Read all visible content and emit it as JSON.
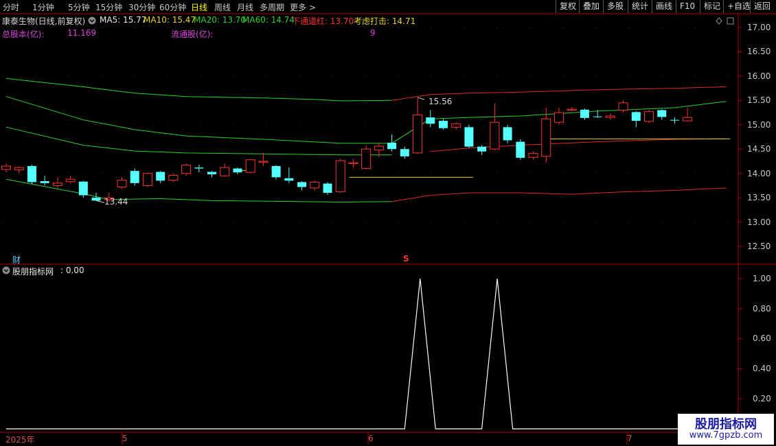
{
  "toolbar": {
    "periods": [
      "分时",
      "1分钟",
      "5分钟",
      "15分钟",
      "30分钟",
      "60分钟",
      "日线",
      "周线",
      "月线",
      "多周期",
      "更多 >"
    ],
    "active_period": "日线",
    "tools": [
      "复权",
      "叠加",
      "多股",
      "统计",
      "画线",
      "F10",
      "标记",
      "+自选",
      "返回"
    ]
  },
  "stock": {
    "title": "康泰生物(日线,前复权)"
  },
  "ma": {
    "ma5": "MA5: 15.77",
    "ma10": "MA10: 15.47",
    "ma20": "MA20: 13.70",
    "ma60": "MA60: 14.74"
  },
  "signals": {
    "lower": "下通道红: 13.70",
    "consider": "考虑打击: 14.71"
  },
  "shares": {
    "total_label": "总股本(亿):",
    "total_value": "11.169",
    "float_label": "流通股(亿):",
    "float_value": "9"
  },
  "price_axis": [
    "17.00",
    "16.50",
    "16.00",
    "15.50",
    "15.00",
    "14.50",
    "14.00",
    "13.50",
    "13.00",
    "12.50"
  ],
  "annotations": {
    "high": "15.56",
    "low": "13.44"
  },
  "markers": {
    "cai": "财",
    "s": "S"
  },
  "indicator": {
    "name": "股朋指标网",
    "value_text": ": 0.00",
    "axis": [
      "1.00",
      "0.80",
      "0.60",
      "0.40",
      "0.20"
    ]
  },
  "dates": [
    "2025年",
    "5",
    "6",
    "7"
  ],
  "watermark": {
    "line1": "股朋指标网",
    "line2": "www.7gpzb.com"
  },
  "colors": {
    "up": "#ff3232",
    "down": "#54ffff",
    "ma_green": "#2bd12b",
    "ma_red": "#dd2a2a",
    "axis_red": "#b00000",
    "consider_yellow": "#e6d22c"
  },
  "chart_data": [
    {
      "type": "candlestick",
      "title": "康泰生物(日线,前复权)",
      "ylim": [
        12.3,
        17.2
      ],
      "candles": [
        {
          "o": 14.08,
          "c": 14.15,
          "h": 14.2,
          "l": 14.02
        },
        {
          "o": 14.07,
          "c": 14.12,
          "h": 14.15,
          "l": 14.0
        },
        {
          "o": 14.15,
          "c": 13.82,
          "h": 14.18,
          "l": 13.78
        },
        {
          "o": 13.84,
          "c": 13.8,
          "h": 13.95,
          "l": 13.75
        },
        {
          "o": 13.75,
          "c": 13.8,
          "h": 13.92,
          "l": 13.7
        },
        {
          "o": 13.83,
          "c": 13.88,
          "h": 13.95,
          "l": 13.79
        },
        {
          "o": 13.83,
          "c": 13.55,
          "h": 13.85,
          "l": 13.5
        },
        {
          "o": 13.5,
          "c": 13.44,
          "h": 13.6,
          "l": 13.44
        },
        {
          "o": 13.46,
          "c": 13.5,
          "h": 13.6,
          "l": 13.42
        },
        {
          "o": 13.72,
          "c": 13.86,
          "h": 13.92,
          "l": 13.68
        },
        {
          "o": 14.05,
          "c": 13.8,
          "h": 14.1,
          "l": 13.75
        },
        {
          "o": 13.75,
          "c": 14.0,
          "h": 14.02,
          "l": 13.72
        },
        {
          "o": 14.03,
          "c": 13.85,
          "h": 14.05,
          "l": 13.8
        },
        {
          "o": 13.86,
          "c": 13.96,
          "h": 14.0,
          "l": 13.82
        },
        {
          "o": 14.0,
          "c": 14.17,
          "h": 14.2,
          "l": 13.95
        },
        {
          "o": 14.12,
          "c": 14.1,
          "h": 14.18,
          "l": 14.02
        },
        {
          "o": 14.03,
          "c": 13.98,
          "h": 14.05,
          "l": 13.92
        },
        {
          "o": 13.95,
          "c": 14.12,
          "h": 14.2,
          "l": 13.93
        },
        {
          "o": 14.1,
          "c": 14.02,
          "h": 14.12,
          "l": 13.98
        },
        {
          "o": 14.02,
          "c": 14.28,
          "h": 14.3,
          "l": 14.0
        },
        {
          "o": 14.23,
          "c": 14.25,
          "h": 14.42,
          "l": 14.15
        },
        {
          "o": 14.15,
          "c": 13.92,
          "h": 14.17,
          "l": 13.88
        },
        {
          "o": 13.9,
          "c": 13.85,
          "h": 14.12,
          "l": 13.8
        },
        {
          "o": 13.82,
          "c": 13.72,
          "h": 13.84,
          "l": 13.65
        },
        {
          "o": 13.7,
          "c": 13.82,
          "h": 13.85,
          "l": 13.65
        },
        {
          "o": 13.79,
          "c": 13.6,
          "h": 13.82,
          "l": 13.56
        },
        {
          "o": 13.62,
          "c": 14.26,
          "h": 14.3,
          "l": 13.6
        },
        {
          "o": 14.2,
          "c": 14.22,
          "h": 14.3,
          "l": 14.12
        },
        {
          "o": 14.1,
          "c": 14.5,
          "h": 14.58,
          "l": 14.08
        },
        {
          "o": 14.48,
          "c": 14.56,
          "h": 14.62,
          "l": 14.33
        },
        {
          "o": 14.63,
          "c": 14.5,
          "h": 14.8,
          "l": 14.45
        },
        {
          "o": 14.5,
          "c": 14.35,
          "h": 14.55,
          "l": 14.3
        },
        {
          "o": 14.42,
          "c": 15.2,
          "h": 15.56,
          "l": 14.4
        },
        {
          "o": 15.15,
          "c": 15.02,
          "h": 15.3,
          "l": 14.95
        },
        {
          "o": 15.08,
          "c": 14.93,
          "h": 15.12,
          "l": 14.9
        },
        {
          "o": 14.95,
          "c": 15.02,
          "h": 15.05,
          "l": 14.9
        },
        {
          "o": 14.95,
          "c": 14.55,
          "h": 15.0,
          "l": 14.52
        },
        {
          "o": 14.55,
          "c": 14.45,
          "h": 14.58,
          "l": 14.38
        },
        {
          "o": 14.5,
          "c": 15.05,
          "h": 15.44,
          "l": 14.47
        },
        {
          "o": 14.95,
          "c": 14.68,
          "h": 15.0,
          "l": 14.62
        },
        {
          "o": 14.65,
          "c": 14.32,
          "h": 14.7,
          "l": 14.28
        },
        {
          "o": 14.33,
          "c": 14.41,
          "h": 14.45,
          "l": 14.28
        },
        {
          "o": 14.35,
          "c": 15.12,
          "h": 15.35,
          "l": 14.22
        },
        {
          "o": 15.05,
          "c": 15.25,
          "h": 15.35,
          "l": 15.0
        },
        {
          "o": 15.3,
          "c": 15.32,
          "h": 15.36,
          "l": 15.28
        },
        {
          "o": 15.31,
          "c": 15.14,
          "h": 15.33,
          "l": 15.1
        },
        {
          "o": 15.17,
          "c": 15.16,
          "h": 15.3,
          "l": 15.14
        },
        {
          "o": 15.15,
          "c": 15.18,
          "h": 15.23,
          "l": 15.1
        },
        {
          "o": 15.3,
          "c": 15.45,
          "h": 15.5,
          "l": 15.25
        },
        {
          "o": 15.26,
          "c": 15.08,
          "h": 15.28,
          "l": 14.95
        },
        {
          "o": 15.07,
          "c": 15.27,
          "h": 15.3,
          "l": 15.03
        },
        {
          "o": 15.3,
          "c": 15.16,
          "h": 15.32,
          "l": 15.1
        },
        {
          "o": 15.1,
          "c": 15.09,
          "h": 15.15,
          "l": 15.02
        },
        {
          "o": 15.08,
          "c": 15.15,
          "h": 15.35,
          "l": 15.06
        }
      ],
      "bands": {
        "upper_outer": [
          [
            0,
            15.95
          ],
          [
            6,
            15.78
          ],
          [
            10,
            15.65
          ],
          [
            14,
            15.58
          ],
          [
            20,
            15.55
          ],
          [
            24,
            15.52
          ],
          [
            26,
            15.49
          ],
          [
            30,
            15.5
          ],
          [
            33,
            15.62
          ],
          [
            36,
            15.65
          ],
          [
            40,
            15.67
          ],
          [
            46,
            15.72
          ],
          [
            52,
            15.75
          ],
          [
            56,
            15.78
          ]
        ],
        "upper_inner": [
          [
            0,
            15.58
          ],
          [
            6,
            15.1
          ],
          [
            10,
            14.9
          ],
          [
            14,
            14.77
          ],
          [
            20,
            14.7
          ],
          [
            26,
            14.62
          ],
          [
            30,
            14.62
          ],
          [
            33,
            15.12
          ],
          [
            36,
            15.15
          ],
          [
            40,
            15.18
          ],
          [
            46,
            15.28
          ],
          [
            52,
            15.35
          ],
          [
            56,
            15.48
          ]
        ],
        "middle": [
          [
            0,
            14.95
          ],
          [
            6,
            14.58
          ],
          [
            10,
            14.46
          ],
          [
            14,
            14.42
          ],
          [
            20,
            14.4
          ],
          [
            26,
            14.38
          ],
          [
            30,
            14.38
          ],
          [
            33,
            14.45
          ],
          [
            36,
            14.52
          ],
          [
            40,
            14.58
          ],
          [
            46,
            14.65
          ],
          [
            52,
            14.7
          ],
          [
            56,
            14.71
          ]
        ],
        "lower_inner": [
          [
            0,
            13.88
          ],
          [
            6,
            13.58
          ],
          [
            8,
            13.46
          ],
          [
            12,
            13.48
          ],
          [
            16,
            13.44
          ],
          [
            20,
            13.43
          ],
          [
            26,
            13.41
          ],
          [
            30,
            13.42
          ],
          [
            33,
            13.55
          ],
          [
            36,
            13.6
          ],
          [
            40,
            13.6
          ],
          [
            44,
            13.57
          ],
          [
            48,
            13.62
          ],
          [
            52,
            13.65
          ],
          [
            56,
            13.7
          ]
        ]
      },
      "levels": [
        {
          "value": 14.06,
          "from": 18,
          "to": 19
        },
        {
          "value": 13.92,
          "from": 27,
          "to": 36
        },
        {
          "value": 14.71,
          "from": 42,
          "to": 56
        }
      ]
    },
    {
      "type": "line",
      "title": "股朋指标网",
      "ylim": [
        0,
        1.1
      ],
      "series": [
        {
          "points": [
            [
              0,
              0
            ],
            [
              31,
              0
            ],
            [
              32.2,
              1.0
            ],
            [
              33.4,
              0
            ],
            [
              37,
              0
            ],
            [
              38.2,
              1.0
            ],
            [
              39.4,
              0
            ],
            [
              56,
              0
            ]
          ]
        }
      ]
    }
  ]
}
